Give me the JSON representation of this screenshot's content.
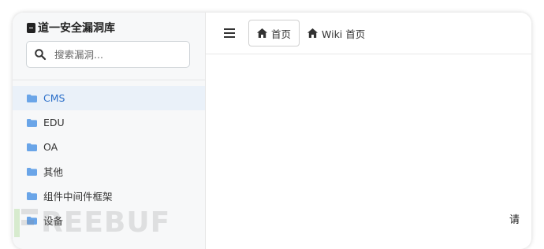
{
  "app": {
    "title": "道一安全漏洞库"
  },
  "search": {
    "placeholder": "搜索漏洞..."
  },
  "sidebar": {
    "items": [
      {
        "label": "CMS",
        "icon": "folder-icon",
        "active": true
      },
      {
        "label": "EDU",
        "icon": "folder-icon",
        "active": false
      },
      {
        "label": "OA",
        "icon": "folder-icon",
        "active": false
      },
      {
        "label": "其他",
        "icon": "folder-icon",
        "active": false
      },
      {
        "label": "组件中间件框架",
        "icon": "folder-icon",
        "active": false
      },
      {
        "label": "设备",
        "icon": "folder-icon",
        "active": false
      }
    ]
  },
  "topbar": {
    "menu_icon": "hamburger-menu-icon",
    "tabs": [
      {
        "label": "首页",
        "icon": "home-icon",
        "active": true
      },
      {
        "label": "Wiki 首页",
        "icon": "home-icon",
        "active": false
      }
    ]
  },
  "content": {
    "partial_text": "请"
  },
  "watermark": {
    "text": "REEBUF"
  },
  "colors": {
    "accent": "#2b6fc9",
    "folder": "#6aa5e8",
    "active_bg": "#eaf1f9",
    "sidebar_bg": "#f7f8f9"
  }
}
